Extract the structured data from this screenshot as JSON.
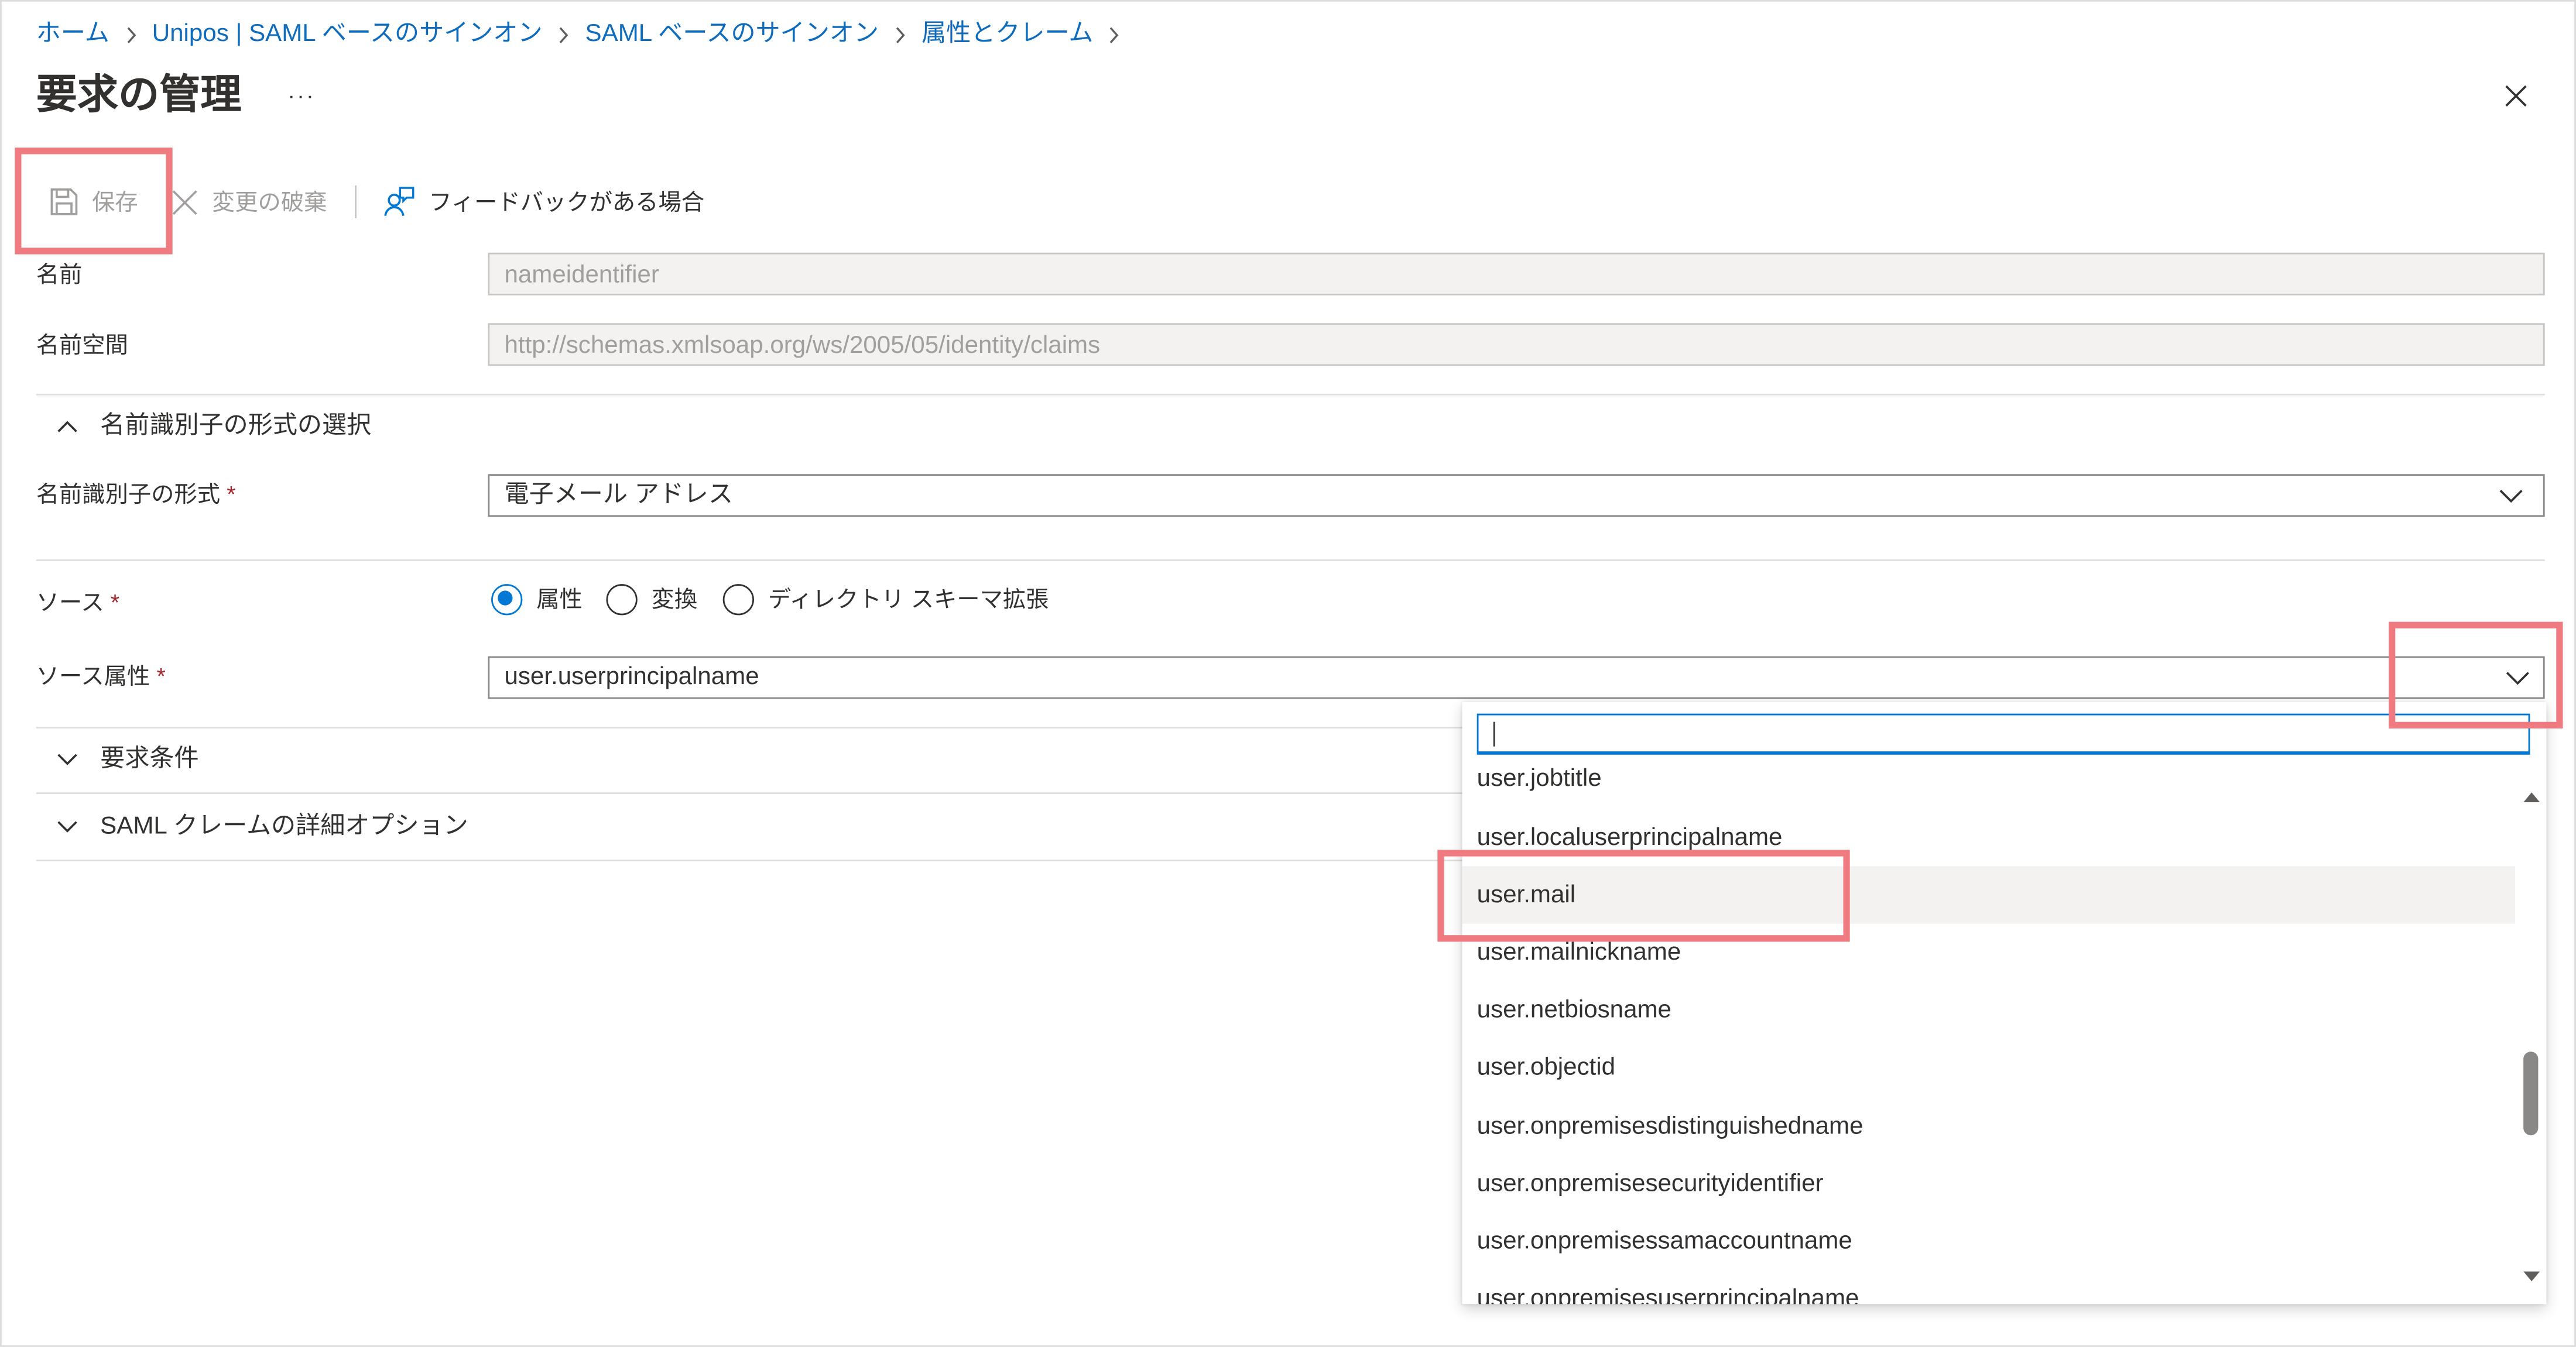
{
  "breadcrumb": [
    {
      "label": "ホーム"
    },
    {
      "label": "Unipos | SAML ベースのサインオン"
    },
    {
      "label": "SAML ベースのサインオン"
    },
    {
      "label": "属性とクレーム"
    }
  ],
  "header": {
    "title": "要求の管理",
    "more_label": "···",
    "close_icon": "close-icon"
  },
  "toolbar": {
    "save_label": "保存",
    "save_icon": "save-icon",
    "save_disabled": true,
    "discard_label": "変更の破棄",
    "discard_icon": "dismiss-icon",
    "discard_disabled": true,
    "feedback_label": "フィードバックがある場合",
    "feedback_icon": "feedback-person-icon"
  },
  "form": {
    "name": {
      "label": "名前",
      "value": "nameidentifier"
    },
    "namespace": {
      "label": "名前空間",
      "value": "http://schemas.xmlsoap.org/ws/2005/05/identity/claims"
    },
    "format_section": {
      "label": "名前識別子の形式の選択",
      "expanded": true
    },
    "format": {
      "label": "名前識別子の形式",
      "required_mark": "*",
      "value": "電子メール アドレス"
    },
    "source": {
      "label": "ソース",
      "required_mark": "*",
      "options": [
        "属性",
        "変換",
        "ディレクトリ スキーマ拡張"
      ],
      "selected_index": 0
    },
    "source_attribute": {
      "label": "ソース属性",
      "required_mark": "*",
      "value": "user.userprincipalname"
    },
    "conditions_section": {
      "label": "要求条件",
      "expanded": false
    },
    "advanced_section": {
      "label": "SAML クレームの詳細オプション",
      "expanded": false
    }
  },
  "dropdown": {
    "open": true,
    "search_value": "",
    "items": [
      "user.jobtitle",
      "user.localuserprincipalname",
      "user.mail",
      "user.mailnickname",
      "user.netbiosname",
      "user.objectid",
      "user.onpremisesdistinguishedname",
      "user.onpremisesecurityidentifier",
      "user.onpremisessamaccountname",
      "user.onpremisesuserprincipalname"
    ],
    "hovered_index": 2
  },
  "colors": {
    "accent": "#0078d4",
    "link": "#0f6cbd",
    "text": "#323130",
    "disabled_text": "#a19f9d",
    "required": "#a4262c",
    "annotation_highlight": "#ef7a80",
    "hover_background": "#f3f2f1"
  }
}
